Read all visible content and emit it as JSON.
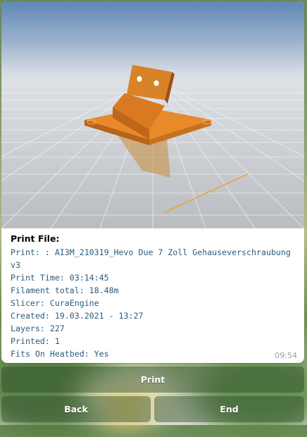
{
  "message": {
    "title": "Print File:",
    "lines": [
      "Print: : AI3M_210319_Hevo Due 7 Zoll Gehauseverschraubung v3",
      "Print Time: 03:14:45",
      "Filament total: 18.48m",
      "Slicer: CuraEngine",
      "Created: 19.03.2021 - 13:27",
      "Layers: 227",
      "Printed: 1",
      "Fits On Heatbed: Yes"
    ],
    "time": "09:54"
  },
  "keyboard": {
    "print_label": "Print",
    "back_label": "Back",
    "end_label": "End"
  }
}
